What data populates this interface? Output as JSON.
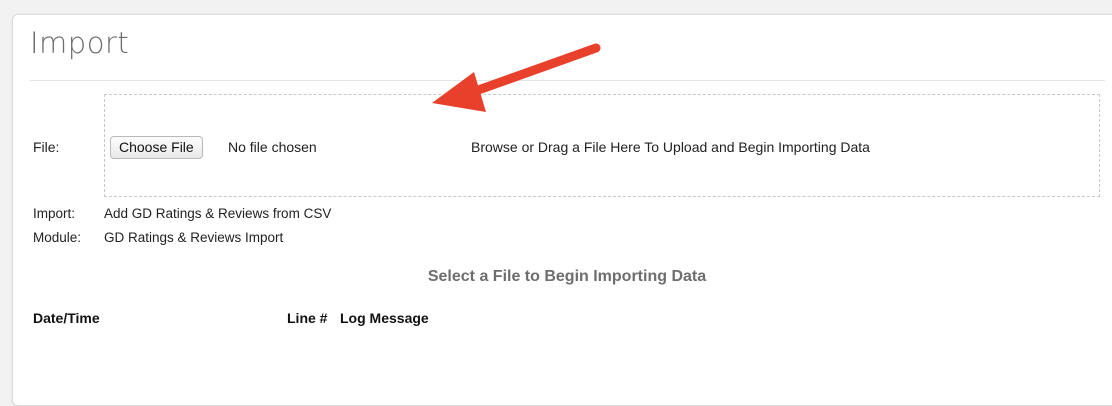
{
  "page": {
    "title": "Import"
  },
  "upload": {
    "file_label": "File:",
    "choose_button_label": "Choose File",
    "no_file_text": "No file chosen",
    "drop_hint": "Browse or Drag a File Here To Upload and Begin Importing Data"
  },
  "details": {
    "import_label": "Import:",
    "import_value": "Add GD Ratings & Reviews from CSV",
    "module_label": "Module:",
    "module_value": "GD Ratings & Reviews Import"
  },
  "status": {
    "message": "Select a File to Begin Importing Data"
  },
  "log_table": {
    "columns": [
      "Date/Time",
      "Line #",
      "Log Message"
    ]
  },
  "annotation": {
    "arrow_color": "#e8402a",
    "arrow_icon": "red-arrow-pointing-to-dropzone"
  }
}
